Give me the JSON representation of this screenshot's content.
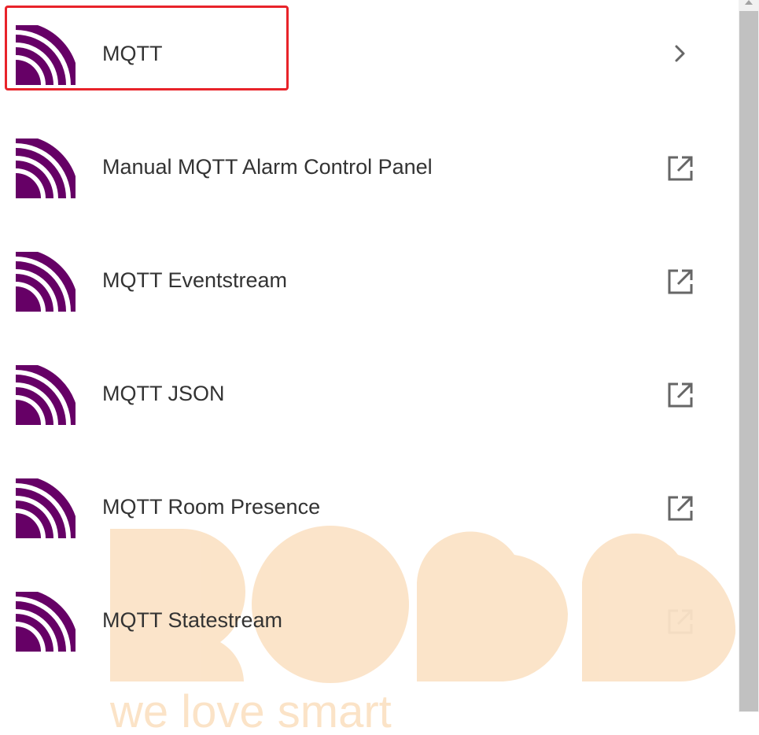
{
  "integrations": {
    "items": [
      {
        "label": "MQTT",
        "action_icon": "chevron-right-icon",
        "logo_icon": "mqtt-logo-icon",
        "selected": true
      },
      {
        "label": "Manual MQTT Alarm Control Panel",
        "action_icon": "open-in-new-icon",
        "logo_icon": "mqtt-logo-icon",
        "selected": false
      },
      {
        "label": "MQTT Eventstream",
        "action_icon": "open-in-new-icon",
        "logo_icon": "mqtt-logo-icon",
        "selected": false
      },
      {
        "label": "MQTT JSON",
        "action_icon": "open-in-new-icon",
        "logo_icon": "mqtt-logo-icon",
        "selected": false
      },
      {
        "label": "MQTT Room Presence",
        "action_icon": "open-in-new-icon",
        "logo_icon": "mqtt-logo-icon",
        "selected": false
      },
      {
        "label": "MQTT Statestream",
        "action_icon": "open-in-new-icon",
        "logo_icon": "mqtt-logo-icon",
        "selected": false
      }
    ]
  },
  "watermark": {
    "logo_letters": "ROBB",
    "tagline": "we love smart"
  },
  "colors": {
    "mqtt_purple": "#660066",
    "highlight_red": "#e8232a",
    "label_text": "#333333",
    "icon_gray": "#666666",
    "watermark_peach": "#fbe3c7"
  }
}
